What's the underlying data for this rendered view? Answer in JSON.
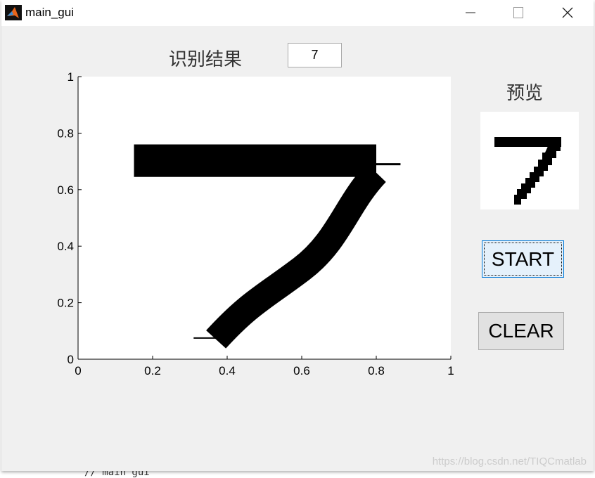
{
  "window": {
    "title": "main_gui",
    "icon": "matlab-icon",
    "controls": [
      "minimize-icon",
      "maximize-icon",
      "close-icon"
    ]
  },
  "result": {
    "label": "识别结果",
    "value": "7"
  },
  "preview": {
    "label": "预览"
  },
  "buttons": {
    "start": "START",
    "clear": "CLEAR"
  },
  "axes": {
    "xticks": [
      "0",
      "0.2",
      "0.4",
      "0.6",
      "0.8",
      "1"
    ],
    "yticks": [
      "0",
      "0.2",
      "0.4",
      "0.6",
      "0.8",
      "1"
    ],
    "xlim": [
      0,
      1
    ],
    "ylim": [
      0,
      1
    ]
  },
  "background_text": "// main gui",
  "watermark": "https://blog.csdn.net/TIQCmatlab"
}
